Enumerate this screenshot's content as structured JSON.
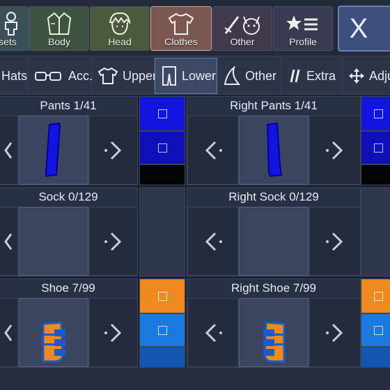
{
  "categories": [
    {
      "id": "presets",
      "label": "sets"
    },
    {
      "id": "body",
      "label": "Body"
    },
    {
      "id": "head",
      "label": "Head"
    },
    {
      "id": "clothes",
      "label": "Clothes"
    },
    {
      "id": "other",
      "label": "Other"
    },
    {
      "id": "profile",
      "label": "Profile"
    }
  ],
  "close_label": "X",
  "subtabs": [
    {
      "id": "hats",
      "label": "Hats"
    },
    {
      "id": "acc",
      "label": "Acc."
    },
    {
      "id": "upper",
      "label": "Upper"
    },
    {
      "id": "lower",
      "label": "Lower"
    },
    {
      "id": "other",
      "label": "Other"
    },
    {
      "id": "extra",
      "label": "Extra"
    },
    {
      "id": "adjust",
      "label": "Adjus"
    }
  ],
  "slots": {
    "pants": {
      "title": "Pants 1/41"
    },
    "right_pants": {
      "title": "Right Pants 1/41"
    },
    "sock": {
      "title": "Sock 0/129"
    },
    "right_sock": {
      "title": "Right Sock 0/129"
    },
    "shoe": {
      "title": "Shoe 7/99"
    },
    "right_shoe": {
      "title": "Right Shoe 7/99"
    }
  },
  "colors": {
    "pants_primary": "#1414e0",
    "pants_secondary": "#1010b8",
    "pants_tertiary": "#050505",
    "shoe_primary": "#f08a1e",
    "shoe_secondary": "#1a7ae0",
    "shoe_tertiary": "#1456b0"
  }
}
